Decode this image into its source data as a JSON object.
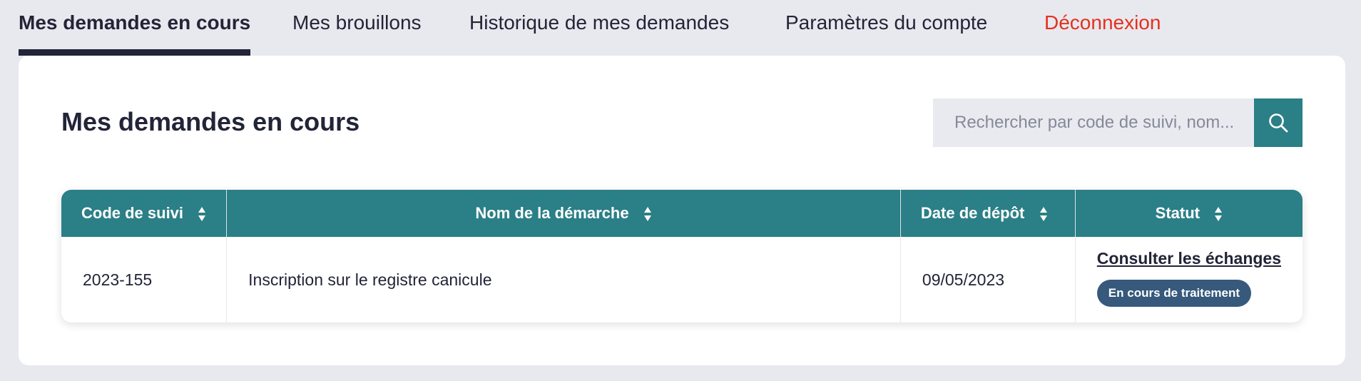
{
  "tabs": [
    {
      "label": "Mes demandes en cours",
      "active": true
    },
    {
      "label": "Mes brouillons",
      "active": false
    },
    {
      "label": "Historique de mes demandes",
      "active": false
    },
    {
      "label": "Paramètres du compte",
      "active": false
    },
    {
      "label": "Déconnexion",
      "active": false
    }
  ],
  "main": {
    "title": "Mes demandes en cours",
    "search": {
      "placeholder": "Rechercher par code de suivi, nom...",
      "value": "",
      "icon": "search-icon"
    }
  },
  "table": {
    "columns": [
      "Code de suivi",
      "Nom de la démarche",
      "Date de dépôt",
      "Statut"
    ],
    "rows": [
      {
        "code": "2023-155",
        "name": "Inscription sur le registre canicule",
        "date": "09/05/2023",
        "link": "Consulter les échanges",
        "status": "En cours de traitement"
      }
    ]
  },
  "colors": {
    "accent": "#2b7f87",
    "text": "#222437",
    "logout": "#e4311f",
    "badge": "#36597c",
    "background": "#e8e9ee"
  }
}
